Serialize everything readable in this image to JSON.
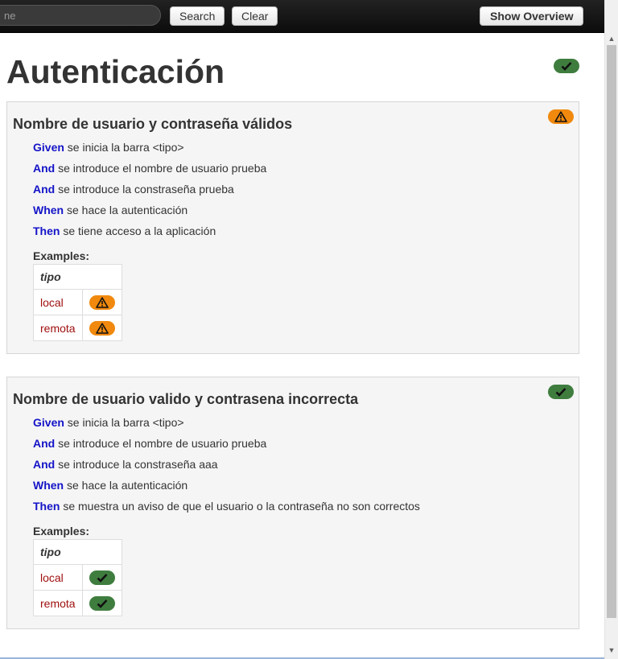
{
  "navbar": {
    "search_placeholder": "ne",
    "search_label": "Search",
    "clear_label": "Clear",
    "overview_label": "Show Overview"
  },
  "feature": {
    "title": "Autenticación",
    "status": "passed"
  },
  "scenarios": [
    {
      "title": "Nombre de usuario y contraseña válidos",
      "status": "pending",
      "steps": [
        {
          "keyword": "Given",
          "text": " se inicia la barra <tipo>"
        },
        {
          "keyword": "And",
          "text": " se introduce el nombre de usuario prueba"
        },
        {
          "keyword": "And",
          "text": " se introduce la constraseña prueba"
        },
        {
          "keyword": "When",
          "text": " se hace la autenticación"
        },
        {
          "keyword": "Then",
          "text": " se tiene acceso a la aplicación"
        }
      ],
      "examples_label": "Examples:",
      "examples_header": "tipo",
      "examples_rows": [
        {
          "value": "local",
          "status": "pending"
        },
        {
          "value": "remota",
          "status": "pending"
        }
      ]
    },
    {
      "title": "Nombre de usuario valido y contrasena incorrecta",
      "status": "passed",
      "steps": [
        {
          "keyword": "Given",
          "text": " se inicia la barra <tipo>"
        },
        {
          "keyword": "And",
          "text": " se introduce el nombre de usuario prueba"
        },
        {
          "keyword": "And",
          "text": " se introduce la constraseña aaa"
        },
        {
          "keyword": "When",
          "text": " se hace la autenticación"
        },
        {
          "keyword": "Then",
          "text": " se muestra un aviso de que el usuario o la contraseña no son correctos"
        }
      ],
      "examples_label": "Examples:",
      "examples_header": "tipo",
      "examples_rows": [
        {
          "value": "local",
          "status": "passed"
        },
        {
          "value": "remota",
          "status": "passed"
        }
      ]
    }
  ],
  "colors": {
    "passed": "#3f7d3f",
    "pending": "#f0890e",
    "keyword": "#1414c8",
    "example_value": "#a01010"
  },
  "icons": {
    "passed": "check-icon",
    "pending": "warning-icon"
  }
}
